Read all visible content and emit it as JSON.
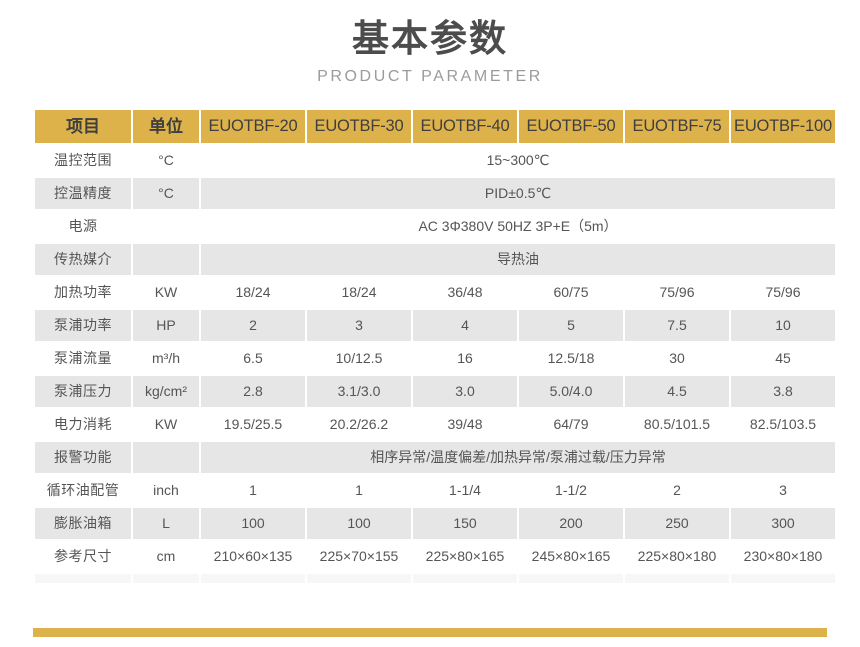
{
  "header": {
    "title": "基本参数",
    "subtitle": "PRODUCT PARAMETER"
  },
  "table": {
    "columns": [
      {
        "key": "item",
        "label": "项目"
      },
      {
        "key": "unit",
        "label": "单位"
      },
      {
        "key": "m20",
        "label": "EUOTBF-20"
      },
      {
        "key": "m30",
        "label": "EUOTBF-30"
      },
      {
        "key": "m40",
        "label": "EUOTBF-40"
      },
      {
        "key": "m50",
        "label": "EUOTBF-50"
      },
      {
        "key": "m75",
        "label": "EUOTBF-75"
      },
      {
        "key": "m100",
        "label": "EUOTBF-100"
      }
    ],
    "rows": [
      {
        "label": "温控范围",
        "unit": "°C",
        "merged": true,
        "merged_value": "15~300℃",
        "values": []
      },
      {
        "label": "控温精度",
        "unit": "°C",
        "merged": true,
        "merged_value": "PID±0.5℃",
        "values": []
      },
      {
        "label": "电源",
        "unit": "",
        "merged": true,
        "merged_value": "AC 3Φ380V 50HZ  3P+E（5m）",
        "values": []
      },
      {
        "label": "传热媒介",
        "unit": "",
        "merged": true,
        "merged_value": "导热油",
        "values": []
      },
      {
        "label": "加热功率",
        "unit": "KW",
        "merged": false,
        "values": [
          "18/24",
          "18/24",
          "36/48",
          "60/75",
          "75/96",
          "75/96"
        ]
      },
      {
        "label": "泵浦功率",
        "unit": "HP",
        "merged": false,
        "values": [
          "2",
          "3",
          "4",
          "5",
          "7.5",
          "10"
        ]
      },
      {
        "label": "泵浦流量",
        "unit": "m³/h",
        "merged": false,
        "values": [
          "6.5",
          "10/12.5",
          "16",
          "12.5/18",
          "30",
          "45"
        ]
      },
      {
        "label": "泵浦压力",
        "unit": "kg/cm²",
        "merged": false,
        "values": [
          "2.8",
          "3.1/3.0",
          "3.0",
          "5.0/4.0",
          "4.5",
          "3.8"
        ]
      },
      {
        "label": "电力消耗",
        "unit": "KW",
        "merged": false,
        "values": [
          "19.5/25.5",
          "20.2/26.2",
          "39/48",
          "64/79",
          "80.5/101.5",
          "82.5/103.5"
        ]
      },
      {
        "label": "报警功能",
        "unit": "",
        "merged": true,
        "merged_value": "相序异常/温度偏差/加热异常/泵浦过载/压力异常",
        "values": []
      },
      {
        "label": "循环油配管",
        "unit": "inch",
        "merged": false,
        "values": [
          "1",
          "1",
          "1-1/4",
          "1-1/2",
          "2",
          "3"
        ]
      },
      {
        "label": "膨胀油箱",
        "unit": "L",
        "merged": false,
        "values": [
          "100",
          "100",
          "150",
          "200",
          "250",
          "300"
        ]
      },
      {
        "label": "参考尺寸",
        "unit": "cm",
        "merged": false,
        "values": [
          "210×60×135",
          "225×70×155",
          "225×80×165",
          "245×80×165",
          "225×80×180",
          "230×80×180"
        ]
      }
    ]
  },
  "colors": {
    "accent_gold": "#deb24a",
    "row_shade": "#e6e6e6",
    "title_gray": "#4c4c4c",
    "subtitle_gray": "#9b9b9b"
  }
}
